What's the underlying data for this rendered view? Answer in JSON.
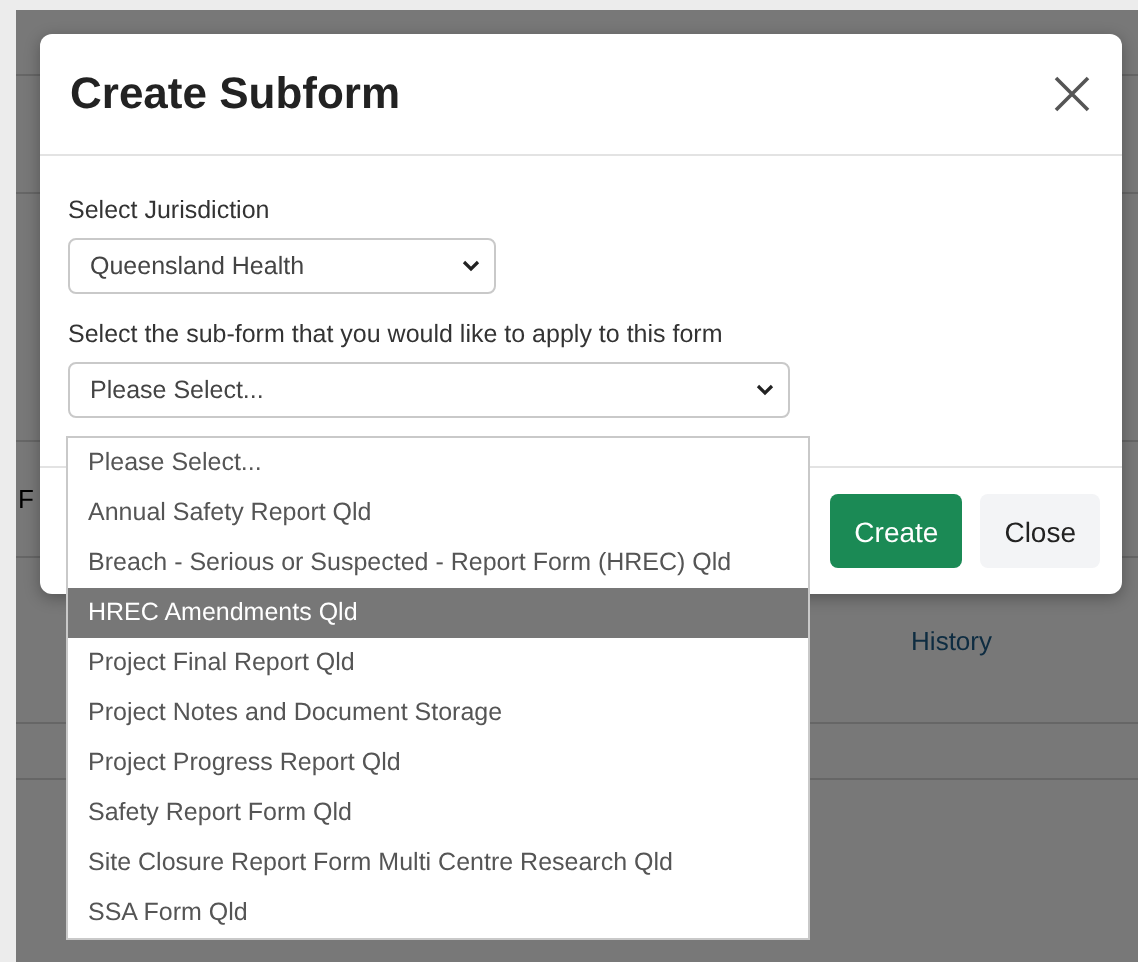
{
  "backdrop": {
    "header_cells": [
      "F"
    ],
    "link": "History"
  },
  "modal": {
    "title": "Create Subform",
    "fields": [
      {
        "label": "Select Jurisdiction",
        "value": "Queensland Health",
        "kind": "short"
      },
      {
        "label": "Select the sub-form that you would like to apply to this form",
        "value": "Please Select...",
        "kind": "wide"
      }
    ],
    "buttons": [
      {
        "label": "Create",
        "kind": "primary"
      },
      {
        "label": "Close",
        "kind": "secondary"
      }
    ]
  },
  "dropdown": {
    "options": [
      {
        "label": "Please Select...",
        "selected": false
      },
      {
        "label": "Annual Safety Report Qld",
        "selected": false
      },
      {
        "label": "Breach - Serious or Suspected - Report Form (HREC) Qld",
        "selected": false
      },
      {
        "label": "HREC Amendments Qld",
        "selected": true
      },
      {
        "label": "Project Final Report Qld",
        "selected": false
      },
      {
        "label": "Project Notes and Document Storage",
        "selected": false
      },
      {
        "label": "Project Progress Report Qld",
        "selected": false
      },
      {
        "label": "Safety Report Form Qld",
        "selected": false
      },
      {
        "label": "Site Closure Report Form Multi Centre Research Qld",
        "selected": false
      },
      {
        "label": "SSA Form Qld",
        "selected": false
      }
    ]
  }
}
